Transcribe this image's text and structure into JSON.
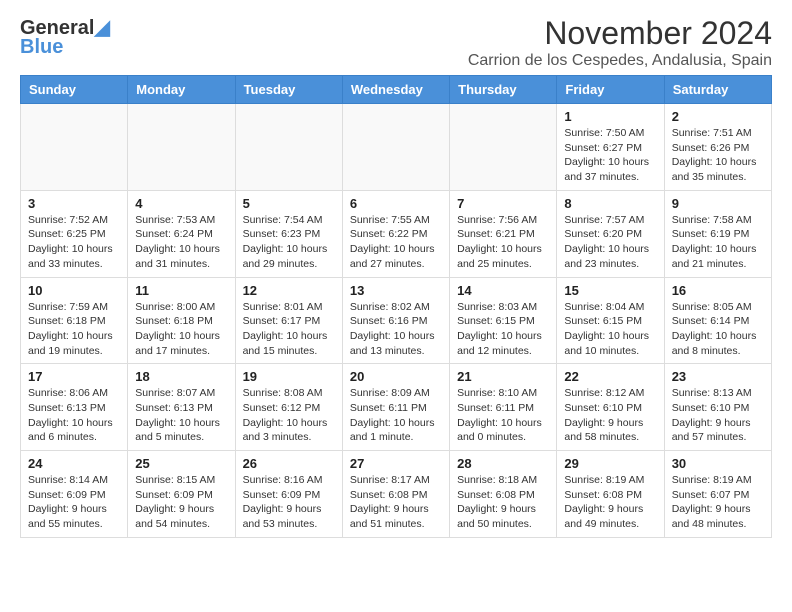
{
  "logo": {
    "line1": "General",
    "line2": "Blue"
  },
  "header": {
    "month": "November 2024",
    "location": "Carrion de los Cespedes, Andalusia, Spain"
  },
  "weekdays": [
    "Sunday",
    "Monday",
    "Tuesday",
    "Wednesday",
    "Thursday",
    "Friday",
    "Saturday"
  ],
  "weeks": [
    [
      {
        "day": "",
        "info": ""
      },
      {
        "day": "",
        "info": ""
      },
      {
        "day": "",
        "info": ""
      },
      {
        "day": "",
        "info": ""
      },
      {
        "day": "",
        "info": ""
      },
      {
        "day": "1",
        "info": "Sunrise: 7:50 AM\nSunset: 6:27 PM\nDaylight: 10 hours and 37 minutes."
      },
      {
        "day": "2",
        "info": "Sunrise: 7:51 AM\nSunset: 6:26 PM\nDaylight: 10 hours and 35 minutes."
      }
    ],
    [
      {
        "day": "3",
        "info": "Sunrise: 7:52 AM\nSunset: 6:25 PM\nDaylight: 10 hours and 33 minutes."
      },
      {
        "day": "4",
        "info": "Sunrise: 7:53 AM\nSunset: 6:24 PM\nDaylight: 10 hours and 31 minutes."
      },
      {
        "day": "5",
        "info": "Sunrise: 7:54 AM\nSunset: 6:23 PM\nDaylight: 10 hours and 29 minutes."
      },
      {
        "day": "6",
        "info": "Sunrise: 7:55 AM\nSunset: 6:22 PM\nDaylight: 10 hours and 27 minutes."
      },
      {
        "day": "7",
        "info": "Sunrise: 7:56 AM\nSunset: 6:21 PM\nDaylight: 10 hours and 25 minutes."
      },
      {
        "day": "8",
        "info": "Sunrise: 7:57 AM\nSunset: 6:20 PM\nDaylight: 10 hours and 23 minutes."
      },
      {
        "day": "9",
        "info": "Sunrise: 7:58 AM\nSunset: 6:19 PM\nDaylight: 10 hours and 21 minutes."
      }
    ],
    [
      {
        "day": "10",
        "info": "Sunrise: 7:59 AM\nSunset: 6:18 PM\nDaylight: 10 hours and 19 minutes."
      },
      {
        "day": "11",
        "info": "Sunrise: 8:00 AM\nSunset: 6:18 PM\nDaylight: 10 hours and 17 minutes."
      },
      {
        "day": "12",
        "info": "Sunrise: 8:01 AM\nSunset: 6:17 PM\nDaylight: 10 hours and 15 minutes."
      },
      {
        "day": "13",
        "info": "Sunrise: 8:02 AM\nSunset: 6:16 PM\nDaylight: 10 hours and 13 minutes."
      },
      {
        "day": "14",
        "info": "Sunrise: 8:03 AM\nSunset: 6:15 PM\nDaylight: 10 hours and 12 minutes."
      },
      {
        "day": "15",
        "info": "Sunrise: 8:04 AM\nSunset: 6:15 PM\nDaylight: 10 hours and 10 minutes."
      },
      {
        "day": "16",
        "info": "Sunrise: 8:05 AM\nSunset: 6:14 PM\nDaylight: 10 hours and 8 minutes."
      }
    ],
    [
      {
        "day": "17",
        "info": "Sunrise: 8:06 AM\nSunset: 6:13 PM\nDaylight: 10 hours and 6 minutes."
      },
      {
        "day": "18",
        "info": "Sunrise: 8:07 AM\nSunset: 6:13 PM\nDaylight: 10 hours and 5 minutes."
      },
      {
        "day": "19",
        "info": "Sunrise: 8:08 AM\nSunset: 6:12 PM\nDaylight: 10 hours and 3 minutes."
      },
      {
        "day": "20",
        "info": "Sunrise: 8:09 AM\nSunset: 6:11 PM\nDaylight: 10 hours and 1 minute."
      },
      {
        "day": "21",
        "info": "Sunrise: 8:10 AM\nSunset: 6:11 PM\nDaylight: 10 hours and 0 minutes."
      },
      {
        "day": "22",
        "info": "Sunrise: 8:12 AM\nSunset: 6:10 PM\nDaylight: 9 hours and 58 minutes."
      },
      {
        "day": "23",
        "info": "Sunrise: 8:13 AM\nSunset: 6:10 PM\nDaylight: 9 hours and 57 minutes."
      }
    ],
    [
      {
        "day": "24",
        "info": "Sunrise: 8:14 AM\nSunset: 6:09 PM\nDaylight: 9 hours and 55 minutes."
      },
      {
        "day": "25",
        "info": "Sunrise: 8:15 AM\nSunset: 6:09 PM\nDaylight: 9 hours and 54 minutes."
      },
      {
        "day": "26",
        "info": "Sunrise: 8:16 AM\nSunset: 6:09 PM\nDaylight: 9 hours and 53 minutes."
      },
      {
        "day": "27",
        "info": "Sunrise: 8:17 AM\nSunset: 6:08 PM\nDaylight: 9 hours and 51 minutes."
      },
      {
        "day": "28",
        "info": "Sunrise: 8:18 AM\nSunset: 6:08 PM\nDaylight: 9 hours and 50 minutes."
      },
      {
        "day": "29",
        "info": "Sunrise: 8:19 AM\nSunset: 6:08 PM\nDaylight: 9 hours and 49 minutes."
      },
      {
        "day": "30",
        "info": "Sunrise: 8:19 AM\nSunset: 6:07 PM\nDaylight: 9 hours and 48 minutes."
      }
    ]
  ]
}
